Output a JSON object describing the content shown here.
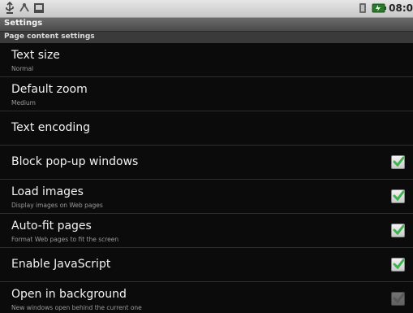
{
  "status_bar": {
    "left_icons": [
      "usb-icon",
      "debug-icon",
      "sd-card-icon"
    ],
    "right_icons": [
      "signal-icon",
      "battery-icon"
    ],
    "time": "08:0"
  },
  "title_bar": {
    "title": "Settings"
  },
  "section": {
    "header": "Page content settings"
  },
  "settings": [
    {
      "title": "Text size",
      "summary": "Normal",
      "checkbox": null
    },
    {
      "title": "Default zoom",
      "summary": "Medium",
      "checkbox": null
    },
    {
      "title": "Text encoding",
      "summary": "",
      "checkbox": null
    },
    {
      "title": "Block pop-up windows",
      "summary": "",
      "checkbox": true
    },
    {
      "title": "Load images",
      "summary": "Display images on Web pages",
      "checkbox": true
    },
    {
      "title": "Auto-fit pages",
      "summary": "Format Web pages to fit the screen",
      "checkbox": true
    },
    {
      "title": "Enable JavaScript",
      "summary": "",
      "checkbox": true
    },
    {
      "title": "Open in background",
      "summary": "New windows open behind the current one",
      "checkbox": false
    }
  ],
  "colors": {
    "check_green": "#3fb34f",
    "background": "#0b0b0b"
  }
}
